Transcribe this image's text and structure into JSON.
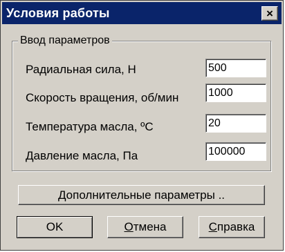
{
  "window": {
    "title": "Условия работы",
    "close_glyph": "×"
  },
  "group": {
    "caption": "Ввод параметров",
    "fields": [
      {
        "label": "Радиальная сила, Н",
        "value": "500"
      },
      {
        "label": "Скорость вращения, об/мин",
        "value": "1000"
      },
      {
        "label": "Температура масла,  ºC",
        "value": "20"
      },
      {
        "label": "Давление масла, Па",
        "value": "100000"
      }
    ]
  },
  "buttons": {
    "extra": "Дополнительные параметры ..",
    "ok": "OK",
    "cancel_first": "О",
    "cancel_rest": "тмена",
    "help_first": "С",
    "help_rest": "правка"
  },
  "colors": {
    "titlebar": "#0a246a",
    "face": "#d4d0c8"
  }
}
